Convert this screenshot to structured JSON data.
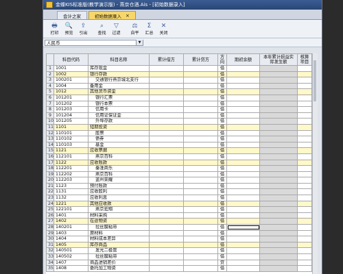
{
  "window": {
    "title": "金蝶KIS标准版(教学演示版) - 燕京仓酒.Ais - [初始数据录入]"
  },
  "tabs": [
    {
      "label": "会计之家",
      "active": false
    },
    {
      "label": "初始数据录入",
      "active": true,
      "close": "×"
    }
  ],
  "toolbar": [
    {
      "icon": "🖶",
      "label": "打印",
      "name": "print"
    },
    {
      "icon": "🔍",
      "label": "预览",
      "name": "preview"
    },
    {
      "icon": "⇪",
      "label": "引出",
      "name": "export"
    },
    {
      "icon": "⌕",
      "label": "查找",
      "name": "find"
    },
    {
      "icon": "▽",
      "label": "过滤",
      "name": "filter"
    },
    {
      "icon": "⚖",
      "label": "自平",
      "name": "balance"
    },
    {
      "icon": "Σ",
      "label": "汇总",
      "name": "summary"
    },
    {
      "icon": "✕",
      "label": "关闭",
      "name": "close"
    }
  ],
  "currency": {
    "value": "人民币",
    "arrow": "▼"
  },
  "columns": [
    "",
    "科目代码",
    "科目名称",
    "累计借方",
    "累计贷方",
    "方向",
    "期初余额",
    "本年累计损益实际发生额",
    "核算项目"
  ],
  "rows": [
    {
      "n": "1",
      "code": "1001",
      "name": "库存现金",
      "dir": "借",
      "hl": false
    },
    {
      "n": "2",
      "code": "1002",
      "name": "银行存款",
      "dir": "借",
      "hl": true
    },
    {
      "n": "3",
      "code": "100201",
      "name": "    交通银行燕京城北支行",
      "dir": "借",
      "hl": false
    },
    {
      "n": "4",
      "code": "1004",
      "name": "备用金",
      "dir": "借",
      "hl": false
    },
    {
      "n": "5",
      "code": "1012",
      "name": "其他货币资金",
      "dir": "借",
      "hl": true
    },
    {
      "n": "6",
      "code": "101201",
      "name": "    银行汇票",
      "dir": "借",
      "hl": false
    },
    {
      "n": "7",
      "code": "101202",
      "name": "    银行本票",
      "dir": "借",
      "hl": false
    },
    {
      "n": "8",
      "code": "101203",
      "name": "    信用卡",
      "dir": "借",
      "hl": false
    },
    {
      "n": "9",
      "code": "101204",
      "name": "    信用证保证金",
      "dir": "借",
      "hl": false
    },
    {
      "n": "10",
      "code": "101205",
      "name": "    外埠存款",
      "dir": "借",
      "hl": false
    },
    {
      "n": "11",
      "code": "1101",
      "name": "短期投资",
      "dir": "借",
      "hl": true
    },
    {
      "n": "12",
      "code": "110101",
      "name": "    股票",
      "dir": "借",
      "hl": false
    },
    {
      "n": "13",
      "code": "110102",
      "name": "    债券",
      "dir": "借",
      "hl": false
    },
    {
      "n": "14",
      "code": "110103",
      "name": "    基金",
      "dir": "借",
      "hl": false
    },
    {
      "n": "15",
      "code": "1121",
      "name": "应收票据",
      "dir": "借",
      "hl": true
    },
    {
      "n": "16",
      "code": "112101",
      "name": "    燕京百科",
      "dir": "借",
      "hl": false
    },
    {
      "n": "17",
      "code": "1122",
      "name": "应收账款",
      "dir": "借",
      "hl": true
    },
    {
      "n": "18",
      "code": "112201",
      "name": "    秦淮商乐",
      "dir": "借",
      "hl": false
    },
    {
      "n": "19",
      "code": "112202",
      "name": "    燕京百科",
      "dir": "借",
      "hl": false
    },
    {
      "n": "20",
      "code": "112203",
      "name": "    蓝州荣耀",
      "dir": "借",
      "hl": false
    },
    {
      "n": "21",
      "code": "1123",
      "name": "预付账款",
      "dir": "借",
      "hl": false
    },
    {
      "n": "22",
      "code": "1131",
      "name": "应收股利",
      "dir": "借",
      "hl": false
    },
    {
      "n": "23",
      "code": "1132",
      "name": "应收利息",
      "dir": "借",
      "hl": false
    },
    {
      "n": "24",
      "code": "1221",
      "name": "其他应收款",
      "dir": "借",
      "hl": true
    },
    {
      "n": "25",
      "code": "122101",
      "name": "    燕京宏翔",
      "dir": "借",
      "hl": false
    },
    {
      "n": "26",
      "code": "1401",
      "name": "材料采购",
      "dir": "借",
      "hl": false
    },
    {
      "n": "27",
      "code": "1402",
      "name": "在途物资",
      "dir": "借",
      "hl": true
    },
    {
      "n": "28",
      "code": "140201",
      "name": "    拉丝膜粘带",
      "dir": "借",
      "hl": false,
      "focus": true
    },
    {
      "n": "29",
      "code": "1403",
      "name": "原材料",
      "dir": "借",
      "hl": false
    },
    {
      "n": "30",
      "code": "1404",
      "name": "材料成本差异",
      "dir": "借",
      "hl": false
    },
    {
      "n": "31",
      "code": "1405",
      "name": "库存商品",
      "dir": "借",
      "hl": true
    },
    {
      "n": "32",
      "code": "140501",
      "name": "    发光二极管",
      "dir": "借",
      "hl": false
    },
    {
      "n": "33",
      "code": "140502",
      "name": "    拉丝膜粘带",
      "dir": "借",
      "hl": false
    },
    {
      "n": "34",
      "code": "1407",
      "name": "商品进销差价",
      "dir": "贷",
      "hl": false
    },
    {
      "n": "35",
      "code": "1408",
      "name": "委托加工物资",
      "dir": "借",
      "hl": false
    }
  ]
}
